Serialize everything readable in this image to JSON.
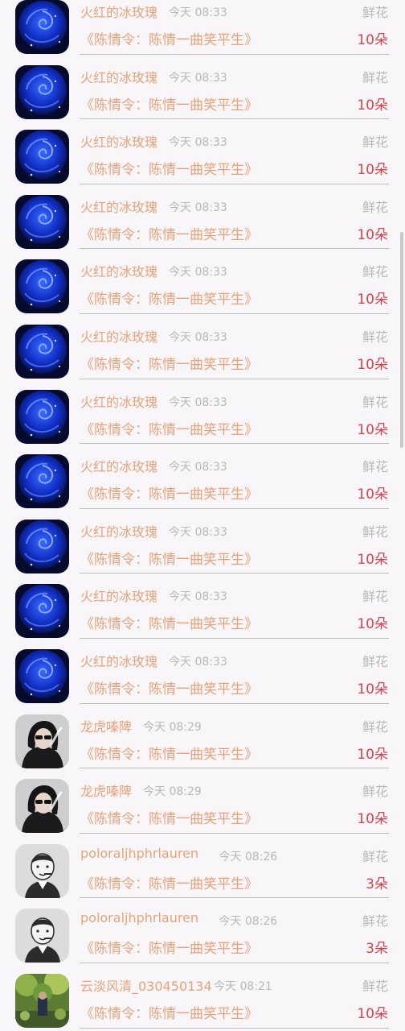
{
  "gifts": [
    {
      "name": "火红的冰玫瑰",
      "time": "今天 08:33",
      "gift": "鲜花",
      "title": "《陈情令：陈情一曲笑平生》",
      "amount": "10朵",
      "avatar": "blue-rose-avatar"
    },
    {
      "name": "火红的冰玫瑰",
      "time": "今天 08:33",
      "gift": "鲜花",
      "title": "《陈情令：陈情一曲笑平生》",
      "amount": "10朵",
      "avatar": "blue-rose-avatar"
    },
    {
      "name": "火红的冰玫瑰",
      "time": "今天 08:33",
      "gift": "鲜花",
      "title": "《陈情令：陈情一曲笑平生》",
      "amount": "10朵",
      "avatar": "blue-rose-avatar"
    },
    {
      "name": "火红的冰玫瑰",
      "time": "今天 08:33",
      "gift": "鲜花",
      "title": "《陈情令：陈情一曲笑平生》",
      "amount": "10朵",
      "avatar": "blue-rose-avatar"
    },
    {
      "name": "火红的冰玫瑰",
      "time": "今天 08:33",
      "gift": "鲜花",
      "title": "《陈情令：陈情一曲笑平生》",
      "amount": "10朵",
      "avatar": "blue-rose-avatar"
    },
    {
      "name": "火红的冰玫瑰",
      "time": "今天 08:33",
      "gift": "鲜花",
      "title": "《陈情令：陈情一曲笑平生》",
      "amount": "10朵",
      "avatar": "blue-rose-avatar"
    },
    {
      "name": "火红的冰玫瑰",
      "time": "今天 08:33",
      "gift": "鲜花",
      "title": "《陈情令：陈情一曲笑平生》",
      "amount": "10朵",
      "avatar": "blue-rose-avatar"
    },
    {
      "name": "火红的冰玫瑰",
      "time": "今天 08:33",
      "gift": "鲜花",
      "title": "《陈情令：陈情一曲笑平生》",
      "amount": "10朵",
      "avatar": "blue-rose-avatar"
    },
    {
      "name": "火红的冰玫瑰",
      "time": "今天 08:33",
      "gift": "鲜花",
      "title": "《陈情令：陈情一曲笑平生》",
      "amount": "10朵",
      "avatar": "blue-rose-avatar"
    },
    {
      "name": "火红的冰玫瑰",
      "time": "今天 08:33",
      "gift": "鲜花",
      "title": "《陈情令：陈情一曲笑平生》",
      "amount": "10朵",
      "avatar": "blue-rose-avatar"
    },
    {
      "name": "火红的冰玫瑰",
      "time": "今天 08:33",
      "gift": "鲜花",
      "title": "《陈情令：陈情一曲笑平生》",
      "amount": "10朵",
      "avatar": "blue-rose-avatar"
    },
    {
      "name": "龙虎嗪陴",
      "time": "今天 08:29",
      "gift": "鲜花",
      "title": "《陈情令：陈情一曲笑平生》",
      "amount": "10朵",
      "avatar": "smoking-girl-avatar"
    },
    {
      "name": "龙虎嗪陴",
      "time": "今天 08:29",
      "gift": "鲜花",
      "title": "《陈情令：陈情一曲笑平生》",
      "amount": "10朵",
      "avatar": "smoking-girl-avatar"
    },
    {
      "name": "poloraljhphrlauren",
      "time": "今天 08:26",
      "gift": "鲜花",
      "title": "《陈情令：陈情一曲笑平生》",
      "amount": "3朵",
      "avatar": "cartoon-man-avatar"
    },
    {
      "name": "poloraljhphrlauren",
      "time": "今天 08:26",
      "gift": "鲜花",
      "title": "《陈情令：陈情一曲笑平生》",
      "amount": "3朵",
      "avatar": "cartoon-man-avatar"
    },
    {
      "name": "云淡风清_030450134",
      "time": "今天 08:21",
      "gift": "鲜花",
      "title": "《陈情令：陈情一曲笑平生》",
      "amount": "10朵",
      "avatar": "green-garden-avatar"
    }
  ],
  "colors": {
    "background": "#f8f6f8",
    "name_text": "#e8a27a",
    "muted_text": "#b9b7b9",
    "amount_text": "#d9434b"
  }
}
